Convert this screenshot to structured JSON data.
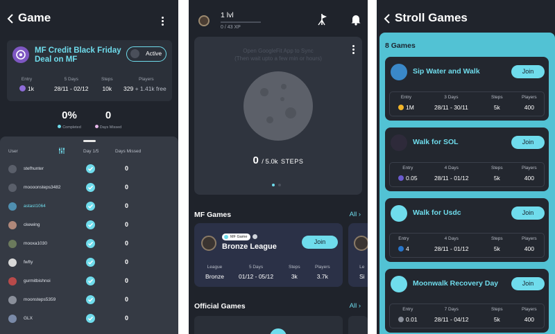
{
  "panel1": {
    "title": "Game",
    "card": {
      "title": "MF Credit Black Friday Deal on MF",
      "status": "Active",
      "stats": [
        {
          "label": "Entry",
          "value": "1k"
        },
        {
          "label": "5 Days",
          "value": "28/11 - 02/12"
        },
        {
          "label": "Steps",
          "value": "10k"
        },
        {
          "label": "Players",
          "value": "329",
          "extra": "+ 1.41k free"
        }
      ]
    },
    "progress": {
      "completed_value": "0%",
      "completed_label": "Completed",
      "missed_value": "0",
      "missed_label": "Days Missed"
    },
    "leaderboard": {
      "col_user": "User",
      "col_day": "Day 1/5",
      "col_missed": "Days Missed",
      "rows": [
        {
          "name": "stefhunter",
          "missed": "0",
          "avatar_color": "#5a5f6a"
        },
        {
          "name": "moooonsteps3482",
          "missed": "0",
          "avatar_color": "#5a5f6a"
        },
        {
          "name": "astast1064",
          "missed": "0",
          "avatar_color": "#4f8fb0",
          "highlight": true
        },
        {
          "name": "ckewing",
          "missed": "0",
          "avatar_color": "#b0887a"
        },
        {
          "name": "mooxa1030",
          "missed": "0",
          "avatar_color": "#6b7a5c"
        },
        {
          "name": "fwfty",
          "missed": "0",
          "avatar_color": "#d8d8d8"
        },
        {
          "name": "gurmitbishnoi",
          "missed": "0",
          "avatar_color": "#b84a4a"
        },
        {
          "name": "moonsteps5359",
          "missed": "0",
          "avatar_color": "#8a8f9a"
        },
        {
          "name": "GLX",
          "missed": "0",
          "avatar_color": "#7a8aa8"
        }
      ]
    }
  },
  "panel2": {
    "level": "1 lvl",
    "xp": "0 / 43 XP",
    "sync_text_1": "Open GoogleFit App to Sync",
    "sync_text_2": "(Then wait upto a few min or hours)",
    "steps_count": "0",
    "steps_target": "/ 5.0k",
    "steps_unit": "STEPS",
    "mf_games_title": "MF Games",
    "all_label": "All",
    "league": {
      "tag": "MF Game",
      "name": "Bronze League",
      "join": "Join",
      "stats": [
        {
          "label": "League",
          "value": "Bronze"
        },
        {
          "label": "5 Days",
          "value": "01/12 - 05/12"
        },
        {
          "label": "Steps",
          "value": "3k"
        },
        {
          "label": "Players",
          "value": "3.7k"
        }
      ],
      "peek_label": "Le",
      "peek_value": "Si"
    },
    "official_title": "Official Games",
    "all_label_2": "All"
  },
  "panel3": {
    "title": "Stroll Games",
    "count": "8 Games",
    "games": [
      {
        "title": "Sip Water and Walk",
        "icon_color": "#3a88c8",
        "join": "Join",
        "stats": [
          {
            "label": "Entry",
            "value": "1M",
            "coin": "#f0b429"
          },
          {
            "label": "3 Days",
            "value": "28/11 - 30/11"
          },
          {
            "label": "Steps",
            "value": "5k"
          },
          {
            "label": "Players",
            "value": "400"
          }
        ]
      },
      {
        "title": "Walk for SOL",
        "icon_color": "#2e2a3a",
        "join": "Join",
        "stats": [
          {
            "label": "Entry",
            "value": "0.05",
            "coin": "#6a5acd"
          },
          {
            "label": "4 Days",
            "value": "28/11 - 01/12"
          },
          {
            "label": "Steps",
            "value": "5k"
          },
          {
            "label": "Players",
            "value": "400"
          }
        ]
      },
      {
        "title": "Walk for Usdc",
        "icon_color": "#6fdcec",
        "join": "Join",
        "stats": [
          {
            "label": "Entry",
            "value": "4",
            "coin": "#2775ca"
          },
          {
            "label": "4 Days",
            "value": "28/11 - 01/12"
          },
          {
            "label": "Steps",
            "value": "5k"
          },
          {
            "label": "Players",
            "value": "400"
          }
        ]
      },
      {
        "title": "Moonwalk Recovery Day",
        "icon_color": "#6fdcec",
        "join": "Join",
        "stats": [
          {
            "label": "Entry",
            "value": "0.01",
            "coin": "#8a8f9a"
          },
          {
            "label": "7 Days",
            "value": "28/11 - 04/12"
          },
          {
            "label": "Steps",
            "value": "5k"
          },
          {
            "label": "Players",
            "value": "400"
          }
        ]
      }
    ]
  },
  "colors": {
    "accent": "#6fdcec",
    "background": "#20242c",
    "card": "#2b3039",
    "league_card": "#2b3147"
  },
  "icons": [
    "back-arrow-icon",
    "more-vert-icon",
    "filter-icon",
    "check-icon",
    "flag-icon",
    "bell-icon",
    "chevron-right-icon",
    "info-icon"
  ]
}
